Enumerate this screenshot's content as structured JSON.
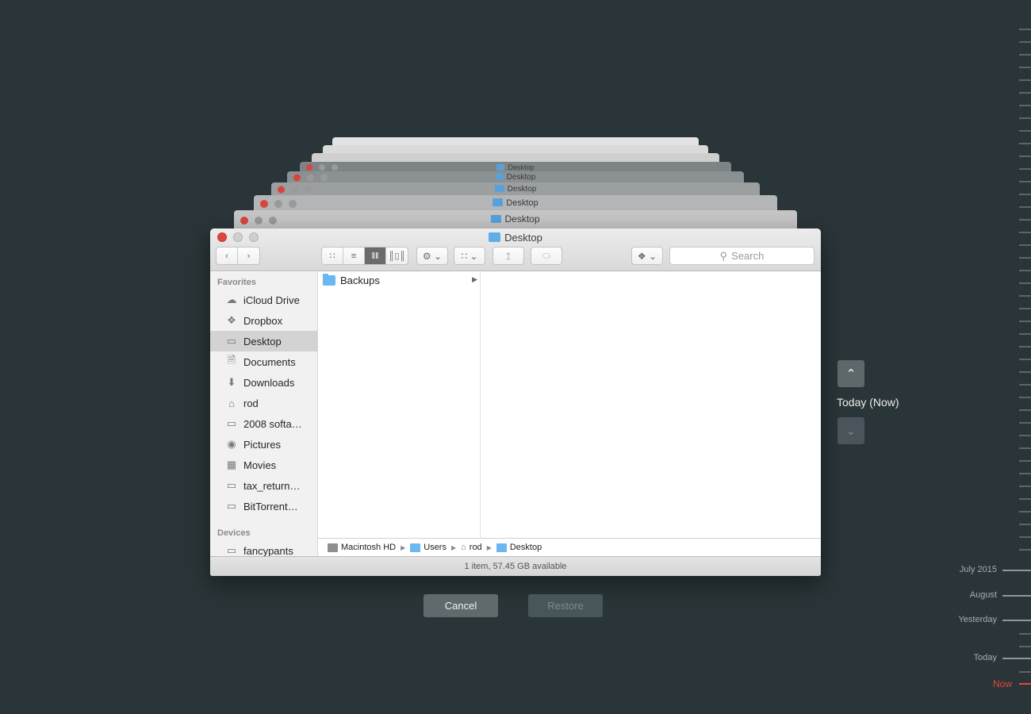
{
  "window": {
    "title": "Desktop",
    "ghost_title": "Desktop"
  },
  "toolbar": {
    "search_placeholder": "Search",
    "back_icon": "chevron-left-icon",
    "forward_icon": "chevron-right-icon"
  },
  "sidebar": {
    "favorites_header": "Favorites",
    "devices_header": "Devices",
    "items": [
      {
        "label": "iCloud Drive",
        "icon": "cloud-icon"
      },
      {
        "label": "Dropbox",
        "icon": "dropbox-icon"
      },
      {
        "label": "Desktop",
        "icon": "desktop-icon",
        "selected": true
      },
      {
        "label": "Documents",
        "icon": "documents-icon"
      },
      {
        "label": "Downloads",
        "icon": "downloads-icon"
      },
      {
        "label": "rod",
        "icon": "home-icon"
      },
      {
        "label": "2008 softa…",
        "icon": "folder-icon"
      },
      {
        "label": "Pictures",
        "icon": "camera-icon"
      },
      {
        "label": "Movies",
        "icon": "film-icon"
      },
      {
        "label": "tax_return…",
        "icon": "folder-icon"
      },
      {
        "label": "BitTorrent…",
        "icon": "folder-icon"
      }
    ],
    "devices": [
      {
        "label": "fancypants",
        "icon": "laptop-icon"
      }
    ]
  },
  "columns": {
    "col1": [
      {
        "label": "Backups"
      }
    ]
  },
  "pathbar": {
    "items": [
      "Macintosh HD",
      "Users",
      "rod",
      "Desktop"
    ]
  },
  "status": "1 item, 57.45 GB available",
  "buttons": {
    "cancel": "Cancel",
    "restore": "Restore"
  },
  "timemachine": {
    "current_label": "Today (Now)",
    "timeline": [
      "July 2015",
      "August",
      "Yesterday",
      "Today",
      "Now"
    ]
  },
  "colors": {
    "background": "#293538",
    "now_accent": "#e8443a",
    "folder": "#6ab8ef"
  }
}
